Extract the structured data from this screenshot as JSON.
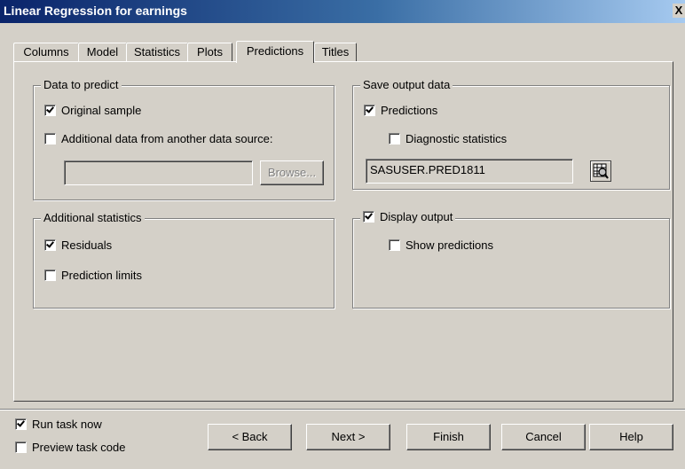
{
  "window": {
    "title": "Linear Regression for earnings",
    "close_glyph": "X"
  },
  "tabs": [
    {
      "label": "Columns",
      "active": false
    },
    {
      "label": "Model",
      "active": false
    },
    {
      "label": "Statistics",
      "active": false
    },
    {
      "label": "Plots",
      "active": false
    },
    {
      "label": "Predictions",
      "active": true
    },
    {
      "label": "Titles",
      "active": false
    }
  ],
  "data_to_predict": {
    "legend": "Data to predict",
    "original_sample": {
      "label": "Original sample",
      "checked": true
    },
    "additional_data": {
      "label": "Additional data from another data source:",
      "checked": false
    },
    "source_value": "",
    "browse_label": "Browse..."
  },
  "additional_statistics": {
    "legend": "Additional statistics",
    "residuals": {
      "label": "Residuals",
      "checked": true
    },
    "prediction_limits": {
      "label": "Prediction limits",
      "checked": false
    }
  },
  "save_output": {
    "legend": "Save output data",
    "predictions": {
      "label": "Predictions",
      "checked": true
    },
    "diagnostic": {
      "label": "Diagnostic statistics",
      "checked": false
    },
    "dataset_value": "SASUSER.PRED1811",
    "browse_icon": "dataset-browse-icon"
  },
  "display_output": {
    "legend": "Display output",
    "checked": true,
    "show_predictions": {
      "label": "Show predictions",
      "checked": false
    }
  },
  "footer": {
    "run_task_now": {
      "label": "Run task now",
      "checked": true
    },
    "preview_task_code": {
      "label": "Preview task code",
      "checked": false
    },
    "buttons": {
      "back": "< Back",
      "next": "Next >",
      "finish": "Finish",
      "cancel": "Cancel",
      "help": "Help"
    }
  }
}
